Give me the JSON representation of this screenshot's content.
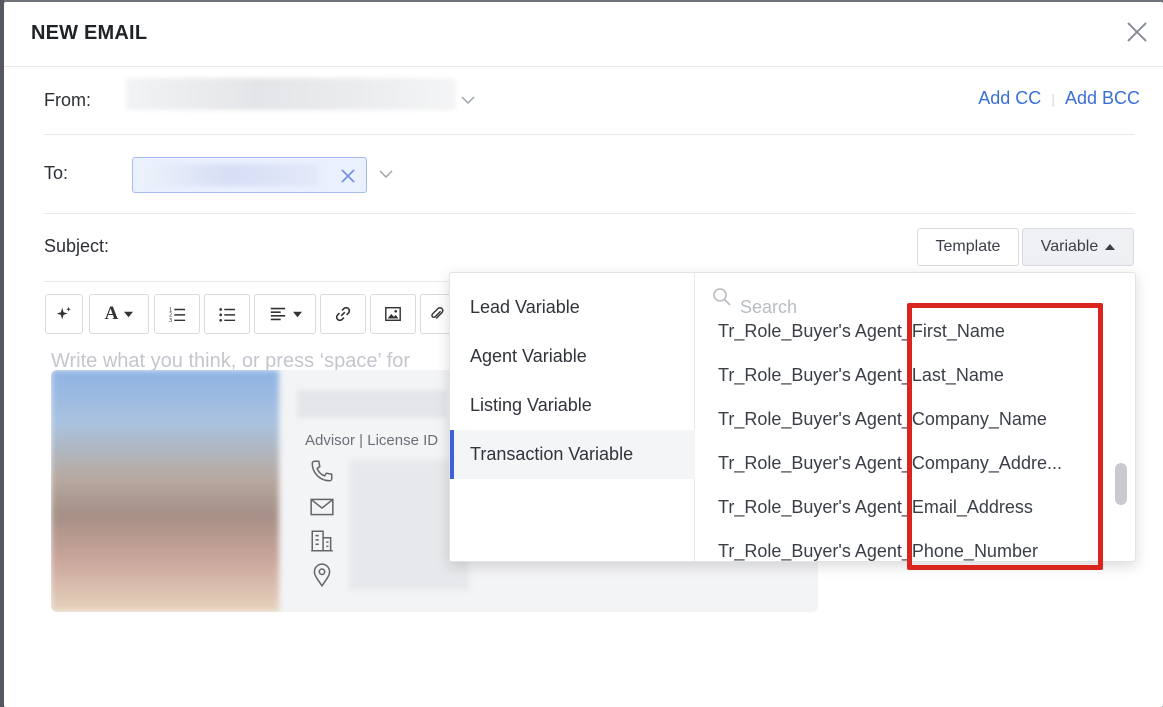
{
  "modal": {
    "title": "NEW EMAIL"
  },
  "from": {
    "label": "From:"
  },
  "cc": {
    "add_cc": "Add CC",
    "add_bcc": "Add BCC"
  },
  "to": {
    "label": "To:"
  },
  "subject": {
    "label": "Subject:",
    "template_button": "Template",
    "variable_button": "Variable"
  },
  "toolbar": {
    "font_label": "A"
  },
  "editor": {
    "placeholder": "Write what you think, or press ‘space’ for"
  },
  "signature": {
    "advisor_text": "Advisor | License ID"
  },
  "dropdown": {
    "categories": [
      {
        "label": "Lead Variable"
      },
      {
        "label": "Agent Variable"
      },
      {
        "label": "Listing Variable"
      },
      {
        "label": "Transaction Variable",
        "selected": true
      }
    ],
    "search_placeholder": "Search",
    "items": [
      {
        "label": "Tr_Role_Buyer's Agent_First_Name"
      },
      {
        "label": "Tr_Role_Buyer's Agent_Last_Name"
      },
      {
        "label": "Tr_Role_Buyer's Agent_Company_Name"
      },
      {
        "label": "Tr_Role_Buyer's Agent_Company_Addre..."
      },
      {
        "label": "Tr_Role_Buyer's Agent_Email_Address"
      },
      {
        "label": "Tr_Role_Buyer's Agent_Phone_Number"
      }
    ]
  },
  "colors": {
    "link": "#3b6fd6",
    "selected_accent": "#3e5fd8",
    "highlight": "#d9251d"
  }
}
